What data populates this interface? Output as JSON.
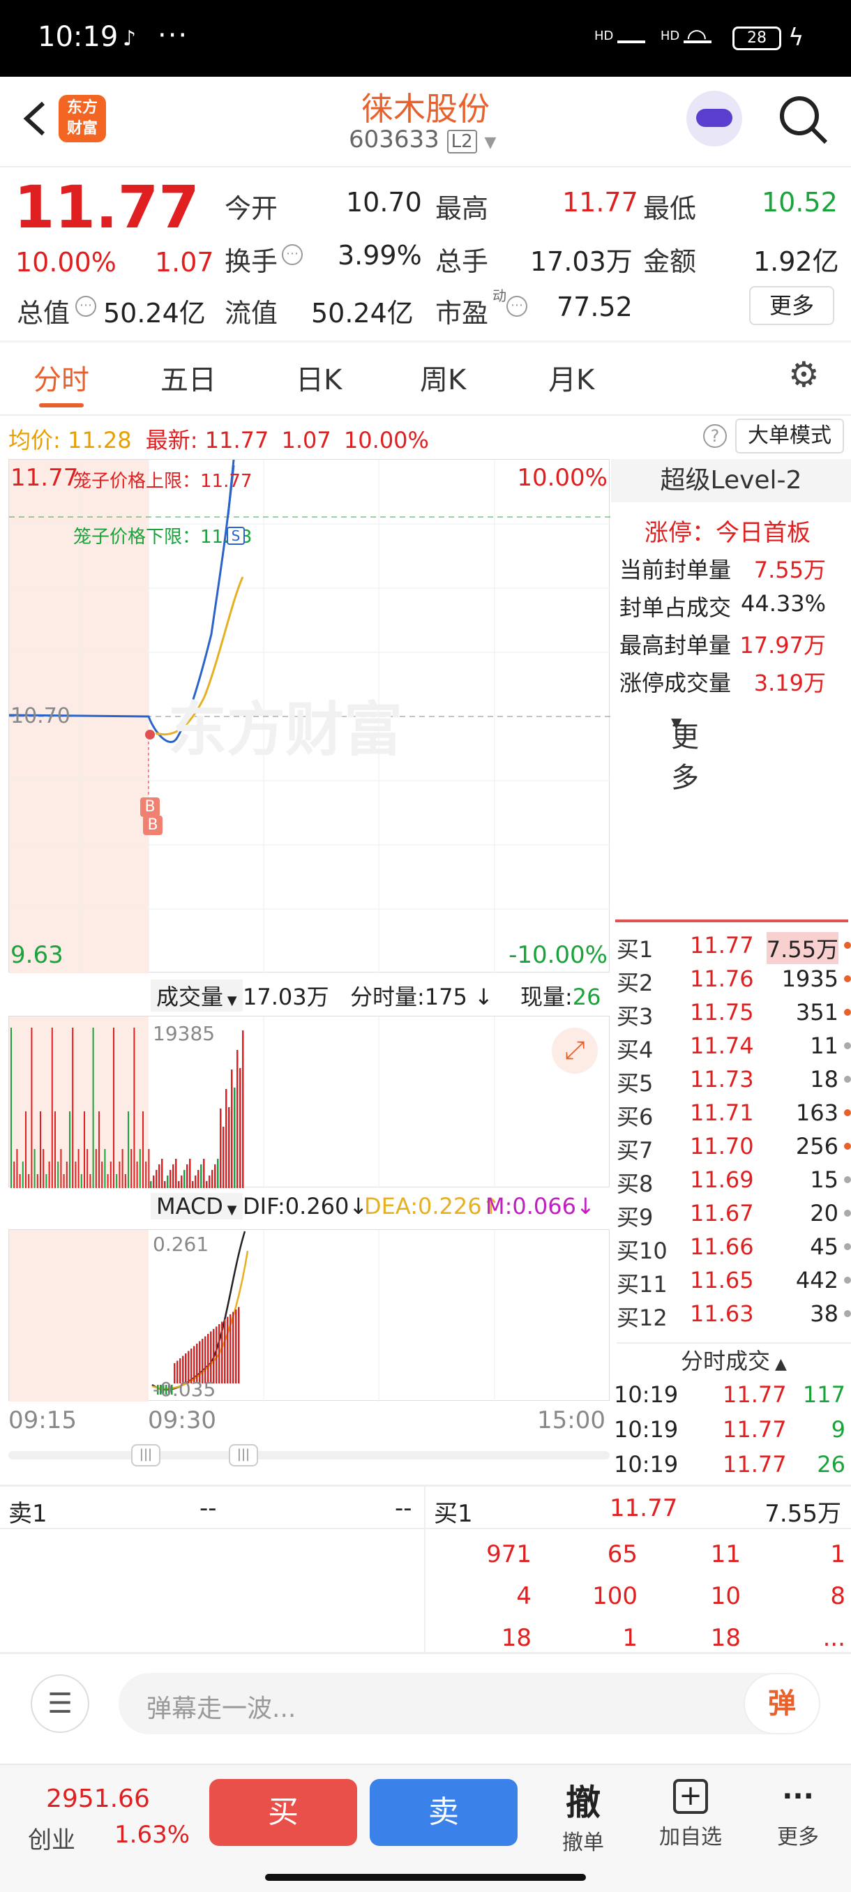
{
  "status_bar": {
    "time": "10:19",
    "tiktok_icon": "tiktok-icon",
    "more": "···",
    "net1": "HD",
    "net2": "HD",
    "battery": "28"
  },
  "header": {
    "title": "徕木股份",
    "code": "603633",
    "level_badge": "L2"
  },
  "quote": {
    "price": "11.77",
    "change_pct": "10.00%",
    "change": "1.07",
    "open_label": "今开",
    "open": "10.70",
    "high_label": "最高",
    "high": "11.77",
    "low_label": "最低",
    "low": "10.52",
    "turnover_label": "换手",
    "turnover": "3.99%",
    "volume_label": "总手",
    "volume": "17.03万",
    "amount_label": "金额",
    "amount": "1.92亿",
    "mktcap_label": "总值",
    "mktcap": "50.24亿",
    "float_label": "流值",
    "float": "50.24亿",
    "pe_label": "市盈",
    "pe_sup": "动",
    "pe": "77.52",
    "more_button": "更多"
  },
  "tabs": [
    {
      "label": "分时",
      "active": true
    },
    {
      "label": "五日"
    },
    {
      "label": "日K"
    },
    {
      "label": "周K"
    },
    {
      "label": "月K"
    },
    {
      "label": "更多"
    }
  ],
  "info_bar": {
    "avg_label": "均价:",
    "avg": "11.28",
    "latest_label": "最新:",
    "latest": "11.77",
    "change": "1.07",
    "pct": "10.00%",
    "big_order_button": "大单模式"
  },
  "chart": {
    "top_left": "11.77",
    "top_right": "10.00%",
    "bottom_left": "9.63",
    "bottom_right": "-10.00%",
    "mid_label": "10.70",
    "cage_upper": "笼子价格上限：11.77",
    "cage_lower": "笼子价格下限：11.53",
    "watermark": "东方财富",
    "marker_s": "S",
    "marker_b1": "B",
    "marker_b2": "B"
  },
  "level2": {
    "title": "超级Level-2",
    "limit_up": "涨停：今日首板",
    "rows": [
      {
        "label": "当前封单量",
        "value": "7.55万"
      },
      {
        "label": "封单占成交",
        "value": "44.33%"
      },
      {
        "label": "最高封单量",
        "value": "17.97万"
      },
      {
        "label": "涨停成交量",
        "value": "3.19万"
      }
    ]
  },
  "bids": [
    {
      "n": "买1",
      "p": "11.77",
      "v": "7.55万",
      "dot": "#e8602c"
    },
    {
      "n": "买2",
      "p": "11.76",
      "v": "1935",
      "dot": "#e8602c"
    },
    {
      "n": "买3",
      "p": "11.75",
      "v": "351",
      "dot": "#e8602c"
    },
    {
      "n": "买4",
      "p": "11.74",
      "v": "11",
      "dot": "#aaaaaa"
    },
    {
      "n": "买5",
      "p": "11.73",
      "v": "18",
      "dot": "#aaaaaa"
    },
    {
      "n": "买6",
      "p": "11.71",
      "v": "163",
      "dot": "#e8602c"
    },
    {
      "n": "买7",
      "p": "11.70",
      "v": "256",
      "dot": "#e8602c"
    },
    {
      "n": "买8",
      "p": "11.69",
      "v": "15",
      "dot": "#aaaaaa"
    },
    {
      "n": "买9",
      "p": "11.67",
      "v": "20",
      "dot": "#aaaaaa"
    },
    {
      "n": "买10",
      "p": "11.66",
      "v": "45",
      "dot": "#aaaaaa"
    },
    {
      "n": "买11",
      "p": "11.65",
      "v": "442",
      "dot": "#aaaaaa"
    },
    {
      "n": "买12",
      "p": "11.63",
      "v": "38",
      "dot": "#aaaaaa"
    }
  ],
  "ticks": {
    "title": "分时成交",
    "rows": [
      {
        "t": "10:19",
        "p": "11.77",
        "v": "117"
      },
      {
        "t": "10:19",
        "p": "11.77",
        "v": "9"
      },
      {
        "t": "10:19",
        "p": "11.77",
        "v": "26"
      }
    ]
  },
  "volume_bar": {
    "selector": "成交量",
    "total": "17.03万",
    "tick_label": "分时量:175",
    "now_label": "现量:",
    "now": "26",
    "max": "19385"
  },
  "macd_bar": {
    "selector": "MACD",
    "dif": "DIF:0.260",
    "dea": "DEA:0.226",
    "m": "M:0.066",
    "max": "0.261",
    "min": "-0.035"
  },
  "time_axis": {
    "start": "09:15",
    "mid": "09:30",
    "end": "15:00"
  },
  "order_table": {
    "sell_label": "卖1",
    "sell_p": "--",
    "sell_v": "--",
    "buy_label": "买1",
    "buy_p": "11.77",
    "buy_v": "7.55万",
    "queue": [
      "971",
      "65",
      "11",
      "1",
      "4",
      "100",
      "10",
      "8",
      "18",
      "1",
      "18",
      "..."
    ]
  },
  "comment": {
    "placeholder": "弹幕走一波...",
    "danmaku_button": "弹"
  },
  "bottom_nav": {
    "index_value": "2951.66",
    "index_name": "创业",
    "index_pct": "1.63%",
    "buy": "买",
    "sell": "卖",
    "cancel_icon": "撤",
    "cancel": "撤单",
    "add": "加自选",
    "more": "更多"
  }
}
